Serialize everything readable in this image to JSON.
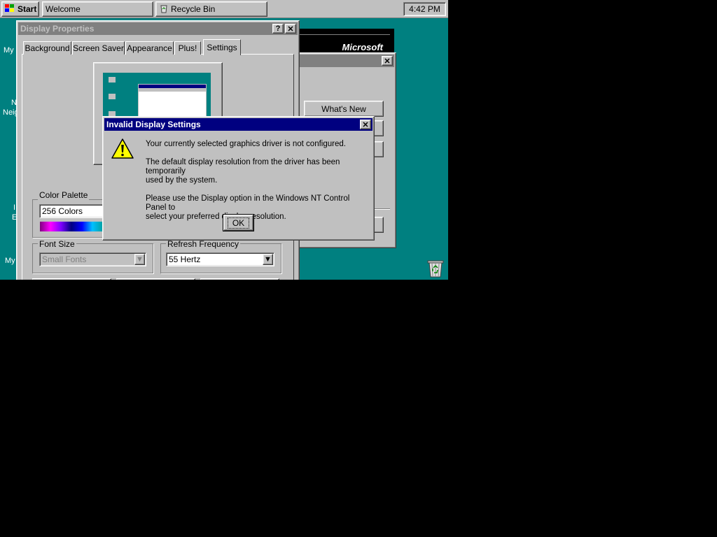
{
  "taskbar": {
    "start_label": "Start",
    "tasks": [
      "Welcome",
      "Recycle Bin"
    ],
    "clock": "4:42 PM"
  },
  "desktop": {
    "icon_labels": [
      "My",
      "N",
      "Neig",
      "I",
      "E",
      "My"
    ]
  },
  "welcome_window": {
    "brand": "Microsoft",
    "buttons": [
      "What's New"
    ]
  },
  "display_properties": {
    "title": "Display Properties",
    "help_label": "?",
    "close_label": "✕",
    "tabs": [
      "Background",
      "Screen Saver",
      "Appearance",
      "Plus!",
      "Settings"
    ],
    "active_tab": "Settings",
    "color_palette": {
      "label": "Color Palette",
      "value": "256 Colors"
    },
    "font_size": {
      "label": "Font Size",
      "value": "Small Fonts"
    },
    "refresh_frequency": {
      "label": "Refresh Frequency",
      "value": "55 Hertz"
    }
  },
  "dialog": {
    "title": "Invalid Display Settings",
    "close_label": "✕",
    "line1": "Your currently selected graphics driver is not configured.",
    "line2a": "The default display resolution from the driver has been temporarily",
    "line2b": "used by the system.",
    "line3a": "Please use the Display option in the Windows NT Control Panel to",
    "line3b": "select your preferred display resolution.",
    "ok_label": "OK",
    "icon": "warning-icon"
  },
  "colors": {
    "desktop": "#008080",
    "title_active": "#000080",
    "face": "#c0c0c0"
  }
}
